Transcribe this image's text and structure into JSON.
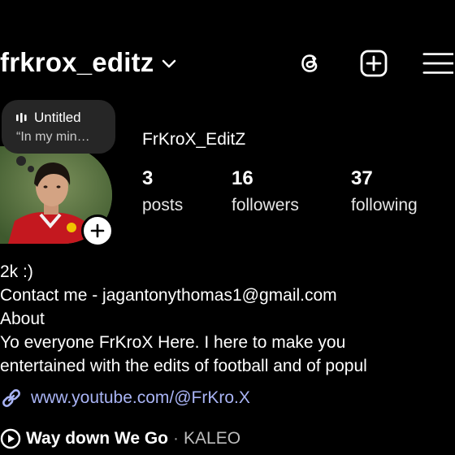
{
  "header": {
    "username": "frkrox_editz",
    "icons": [
      "chevron-down-icon",
      "threads-icon",
      "create-post-icon",
      "menu-icon"
    ]
  },
  "note": {
    "title": "Untitled",
    "text": "“In my min…"
  },
  "profile": {
    "display_name": "FrKroX_EditZ",
    "stats": {
      "posts": {
        "value": "3",
        "label": "posts"
      },
      "followers": {
        "value": "16",
        "label": "followers"
      },
      "following": {
        "value": "37",
        "label": "following"
      }
    }
  },
  "bio": {
    "lines": [
      "2k :)",
      "Contact me - jagantonythomas1@gmail.com",
      "About",
      "Yo everyone FrKroX Here. I here to make you",
      "entertained with the edits of football and of popul"
    ]
  },
  "link": {
    "text": "www.youtube.com/@FrKro.X"
  },
  "music": {
    "song": "Way down We Go",
    "separator": "·",
    "artist": "KALEO"
  },
  "colors": {
    "background": "#000000",
    "link": "#a9b4f5",
    "note_bubble": "#262626"
  }
}
